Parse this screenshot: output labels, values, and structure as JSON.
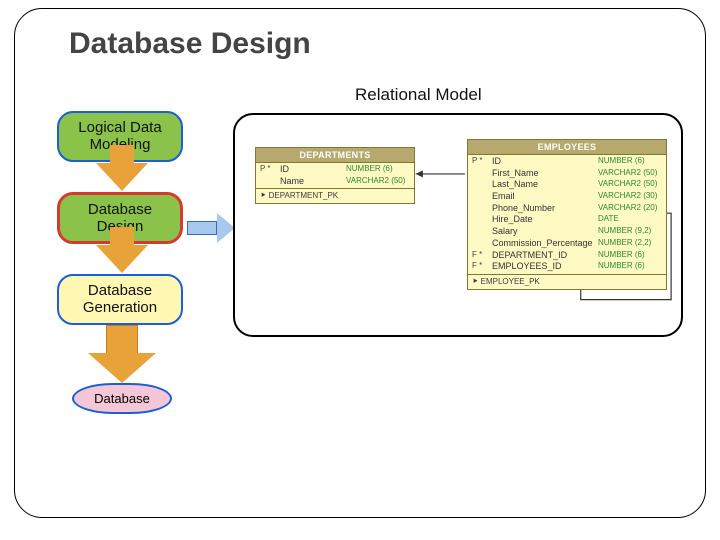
{
  "title": "Database Design",
  "subtitle": "Relational Model",
  "flow": {
    "stage1": "Logical Data\nModeling",
    "stage2": "Database\nDesign",
    "stage3": "Database\nGeneration",
    "final": "Database"
  },
  "tables": {
    "departments": {
      "name": "DEPARTMENTS",
      "pk": "DEPARTMENT_PK",
      "cols": [
        {
          "flags": "P *",
          "name": "ID",
          "type": "NUMBER (6)"
        },
        {
          "flags": "",
          "name": "Name",
          "type": "VARCHAR2 (50)"
        }
      ]
    },
    "employees": {
      "name": "EMPLOYEES",
      "pk": "EMPLOYEE_PK",
      "cols": [
        {
          "flags": "P *",
          "name": "ID",
          "type": "NUMBER (6)"
        },
        {
          "flags": "",
          "name": "First_Name",
          "type": "VARCHAR2 (50)"
        },
        {
          "flags": "",
          "name": "Last_Name",
          "type": "VARCHAR2 (50)"
        },
        {
          "flags": "",
          "name": "Email",
          "type": "VARCHAR2 (30)"
        },
        {
          "flags": "",
          "name": "Phone_Number",
          "type": "VARCHAR2 (20)"
        },
        {
          "flags": "",
          "name": "Hire_Date",
          "type": "DATE"
        },
        {
          "flags": "",
          "name": "Salary",
          "type": "NUMBER (9,2)"
        },
        {
          "flags": "",
          "name": "Commission_Percentage",
          "type": "NUMBER (2,2)"
        },
        {
          "flags": "F *",
          "name": "DEPARTMENT_ID",
          "type": "NUMBER (6)"
        },
        {
          "flags": "F *",
          "name": "EMPLOYEES_ID",
          "type": "NUMBER (6)"
        }
      ]
    }
  }
}
